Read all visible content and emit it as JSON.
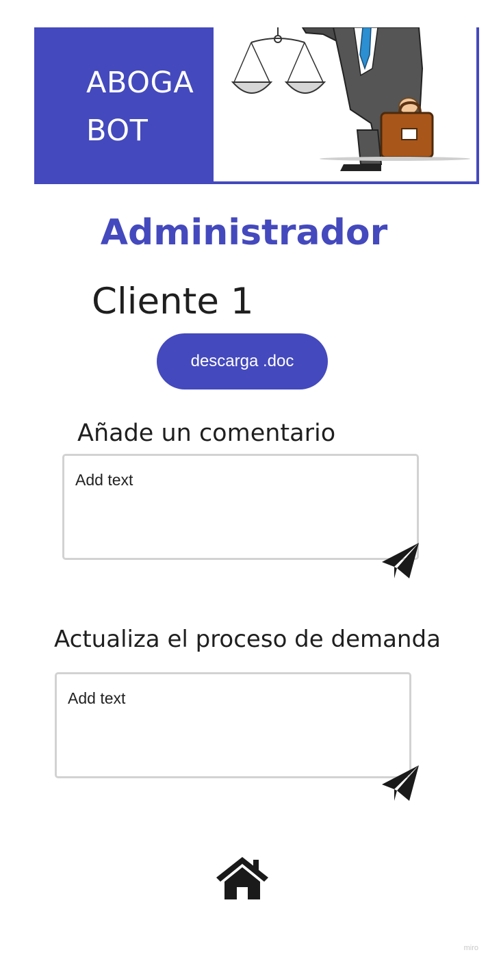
{
  "banner": {
    "brand_line1": "ABOGA",
    "brand_line2": "BOT",
    "illustration": "lawyer-with-scales-and-briefcase"
  },
  "page_title": "Administrador",
  "client": {
    "name": "Cliente 1"
  },
  "download_button": {
    "label": "descarga .doc"
  },
  "comment_section": {
    "label": "Añade un comentario",
    "placeholder": "Add text",
    "send_icon": "send-icon"
  },
  "process_section": {
    "label": "Actualiza el proceso de demanda",
    "placeholder": "Add text",
    "send_icon": "send-icon"
  },
  "footer": {
    "home_icon": "home-icon"
  },
  "watermark": "miro",
  "colors": {
    "brand": "#4449bd",
    "text": "#1f1f1f",
    "border": "#d2d2d2"
  }
}
